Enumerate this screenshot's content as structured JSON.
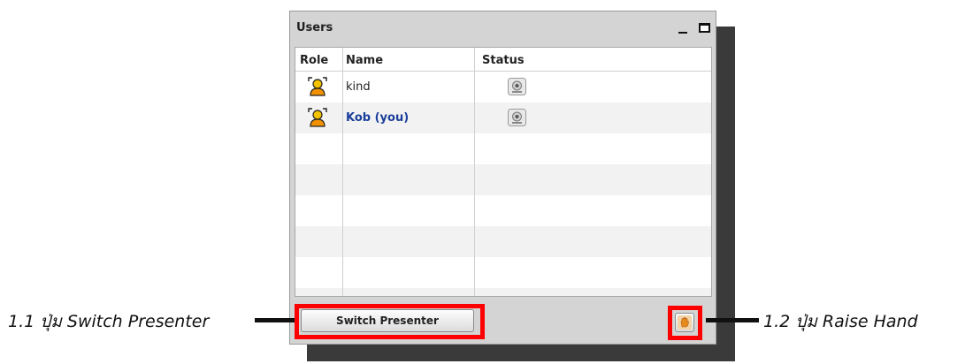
{
  "panel": {
    "title": "Users",
    "columns": {
      "role": "Role",
      "name": "Name",
      "status": "Status"
    },
    "users": [
      {
        "name": "kind",
        "role_icon": "viewer-icon",
        "status_icon": "webcam-icon",
        "is_you": false
      },
      {
        "name": "Kob (you)",
        "role_icon": "viewer-icon",
        "status_icon": "webcam-icon",
        "is_you": true
      }
    ],
    "empty_rows": 6,
    "switch_presenter_label": "Switch Presenter",
    "raise_hand_icon": "raise-hand-icon"
  },
  "annotations": {
    "left": "1.1 ปุ่ม Switch Presenter",
    "right": "1.2 ปุ่ม Raise Hand"
  },
  "colors": {
    "highlight": "#ff0000",
    "you_name": "#1a3e9a",
    "panel_bg": "#d4d4d4",
    "row_alt": "#f2f2f2"
  }
}
